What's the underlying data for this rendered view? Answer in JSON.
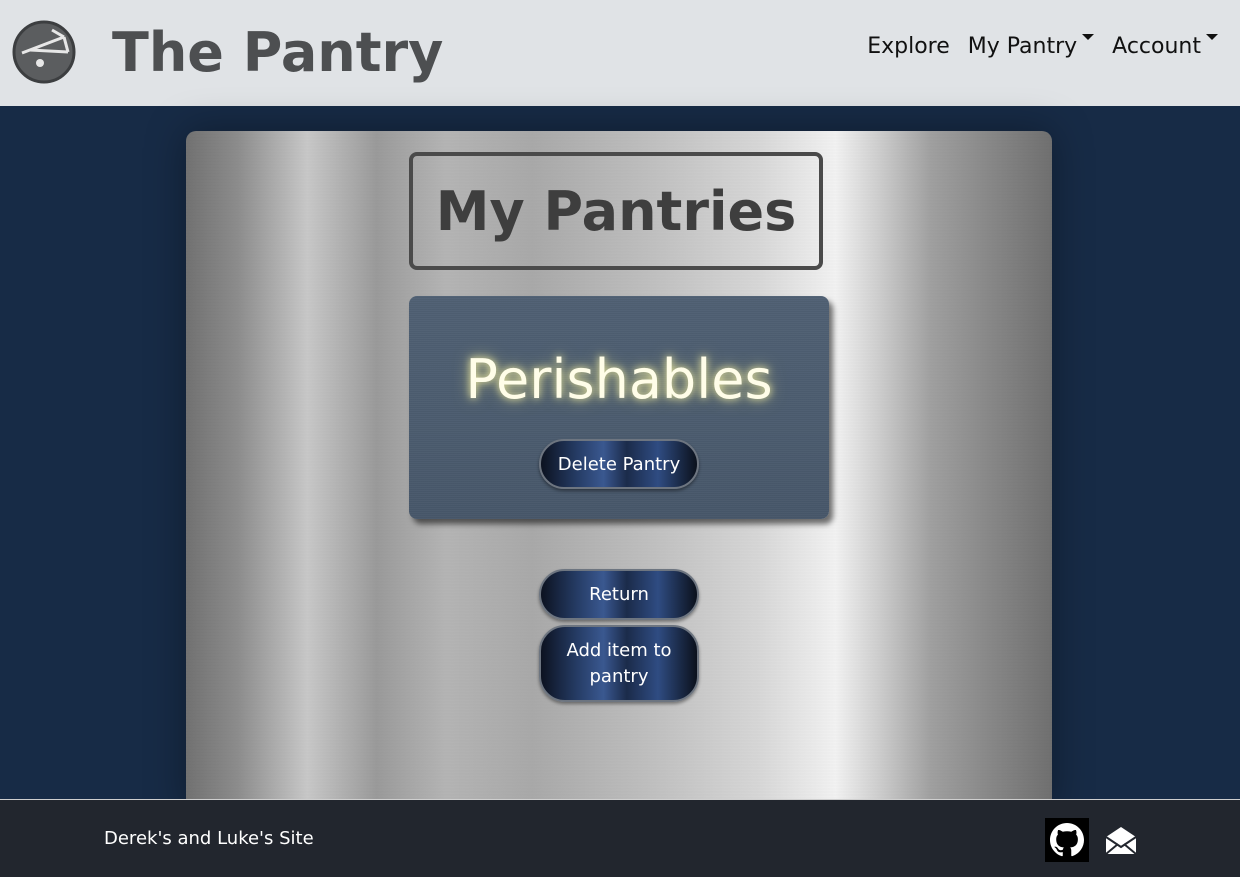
{
  "header": {
    "brand": "The Pantry",
    "logo_icon": "scale-icon",
    "nav": [
      {
        "label": "Explore",
        "dropdown": false
      },
      {
        "label": "My Pantry",
        "dropdown": true
      },
      {
        "label": "Account",
        "dropdown": true
      }
    ]
  },
  "main": {
    "title": "My Pantries",
    "pantry": {
      "name": "Perishables",
      "delete_label": "Delete Pantry"
    },
    "return_label": "Return",
    "add_item_label": "Add item to pantry"
  },
  "footer": {
    "text": "Derek's and Luke's Site",
    "icons": [
      "github-icon",
      "mail-icon"
    ]
  },
  "colors": {
    "background": "#172b46",
    "header_bg": "#e0e3e6",
    "footer_bg": "#22262e",
    "card_bg": "#4a5b6e"
  }
}
